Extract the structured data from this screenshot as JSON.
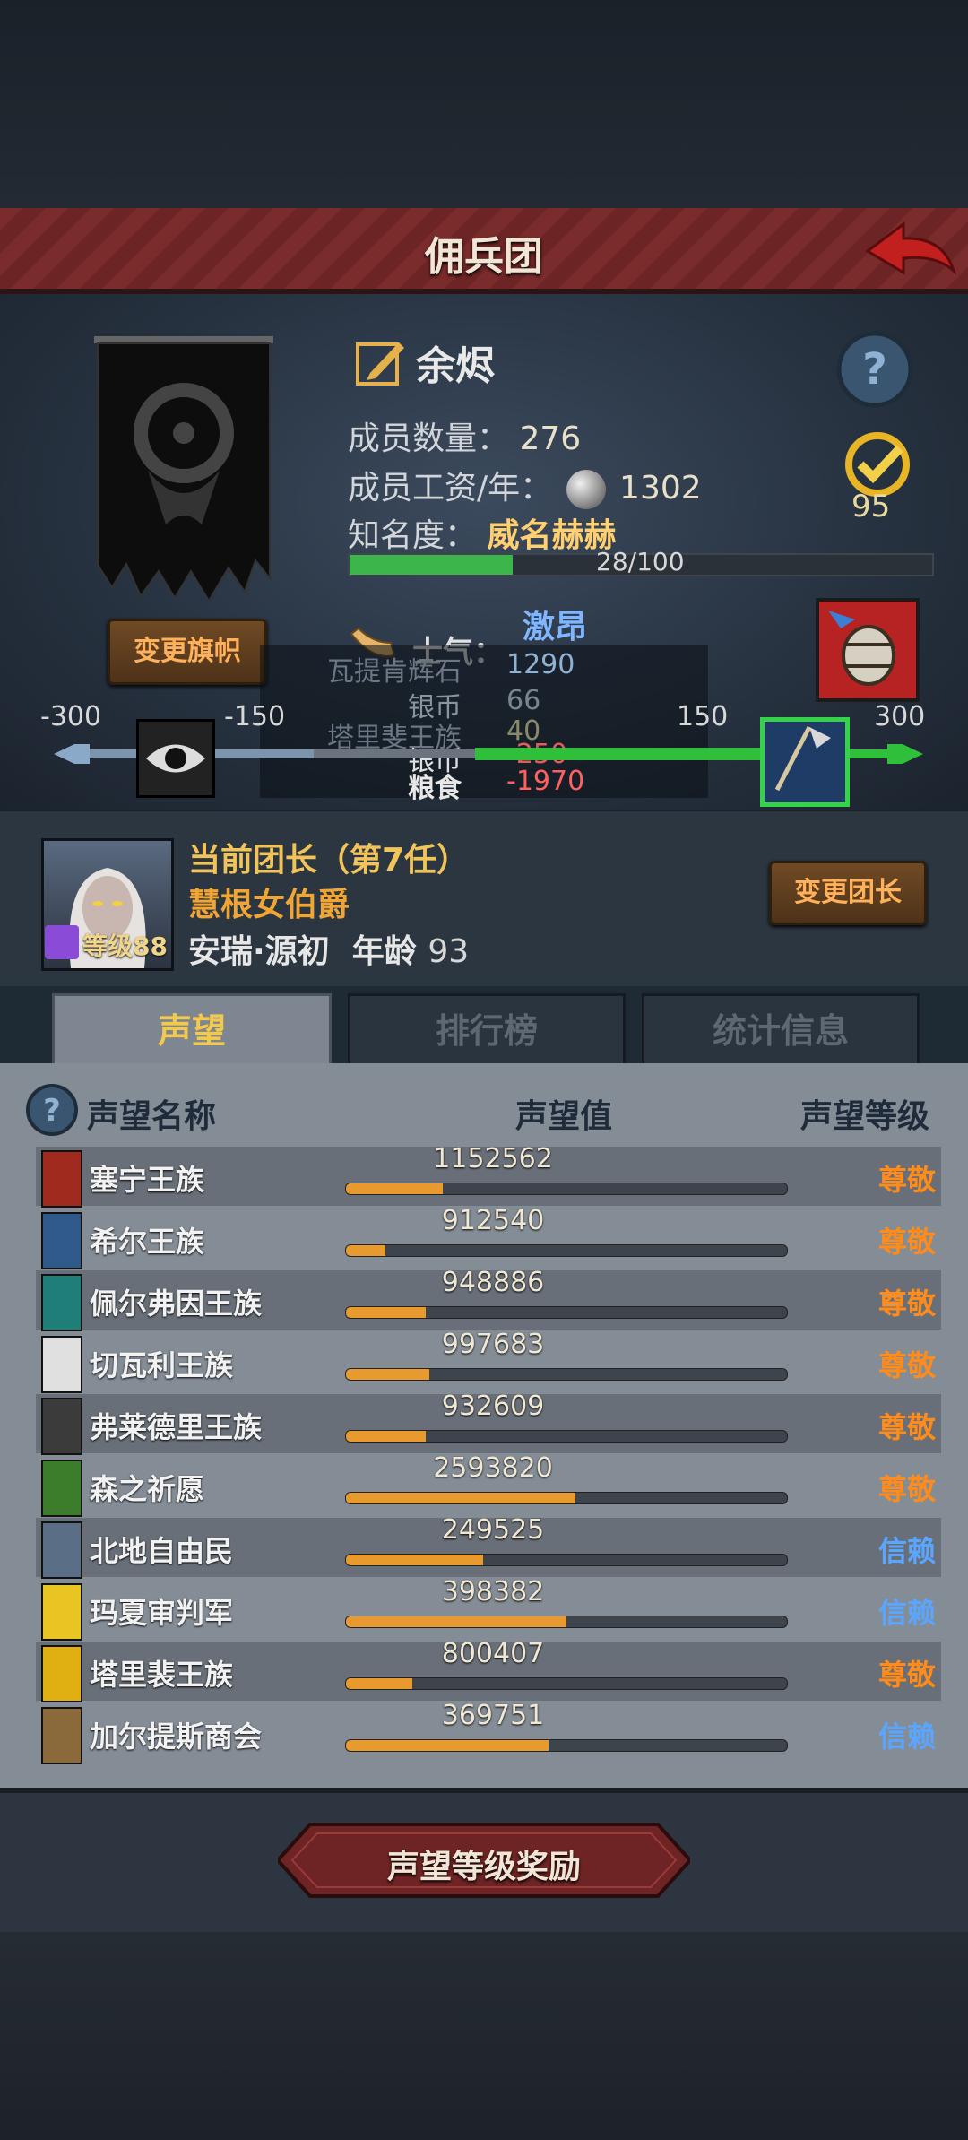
{
  "header": {
    "title": "佣兵团",
    "back_icon": "back-arrow-icon"
  },
  "mercenary": {
    "name": "余烬",
    "members_label": "成员数量：",
    "members_value": "276",
    "salary_label": "成员工资/年：",
    "salary_value": "1302",
    "fame_label": "知名度：",
    "fame_value": "威名赫赫",
    "fame_progress": "28/100",
    "fame_fraction": 0.28,
    "score_value": "95",
    "change_flag_label": "变更旗帜"
  },
  "morale": {
    "label": "士气：",
    "state": "激昂",
    "tooltip_rows": [
      {
        "name": "瓦提肯辉石",
        "value": "1290"
      },
      {
        "name": "银币",
        "value": "66"
      },
      {
        "name": "塔里斐王族",
        "value": "40"
      },
      {
        "name": "银币",
        "value": "-250"
      },
      {
        "name": "粮食",
        "value": "-1970"
      }
    ],
    "ticks": [
      "-300",
      "-150",
      "150",
      "300"
    ]
  },
  "leader": {
    "title": "当前团长（第7任）",
    "name": "慧根女伯爵",
    "race": "安瑞·源初",
    "age_label": "年龄",
    "age_value": "93",
    "level": "等级88",
    "change_label": "变更团长"
  },
  "tabs": [
    {
      "label": "声望",
      "active": true
    },
    {
      "label": "排行榜",
      "active": false
    },
    {
      "label": "统计信息",
      "active": false
    }
  ],
  "table": {
    "col_name": "声望名称",
    "col_value": "声望值",
    "col_level": "声望等级",
    "rows": [
      {
        "name": "塞宁王族",
        "value": "1152562",
        "fill": 0.22,
        "level": "尊敬",
        "color": "#a02a1e"
      },
      {
        "name": "希尔王族",
        "value": "912540",
        "fill": 0.09,
        "level": "尊敬",
        "color": "#2f5a8a"
      },
      {
        "name": "佩尔弗因王族",
        "value": "948886",
        "fill": 0.18,
        "level": "尊敬",
        "color": "#1f7f78"
      },
      {
        "name": "切瓦利王族",
        "value": "997683",
        "fill": 0.19,
        "level": "尊敬",
        "color": "#e0e0e0"
      },
      {
        "name": "弗莱德里王族",
        "value": "932609",
        "fill": 0.18,
        "level": "尊敬",
        "color": "#3b3b3b"
      },
      {
        "name": "森之祈愿",
        "value": "2593820",
        "fill": 0.52,
        "level": "尊敬",
        "color": "#3b7d2a"
      },
      {
        "name": "北地自由民",
        "value": "249525",
        "fill": 0.31,
        "level": "信赖",
        "color": "#5a6f86"
      },
      {
        "name": "玛夏审判军",
        "value": "398382",
        "fill": 0.5,
        "level": "信赖",
        "color": "#e8c522"
      },
      {
        "name": "塔里裴王族",
        "value": "800407",
        "fill": 0.15,
        "level": "尊敬",
        "color": "#e0b012"
      },
      {
        "name": "加尔提斯商会",
        "value": "369751",
        "fill": 0.46,
        "level": "信赖",
        "color": "#8a6a3a"
      }
    ]
  },
  "footer": {
    "reward_button": "声望等级奖励"
  }
}
